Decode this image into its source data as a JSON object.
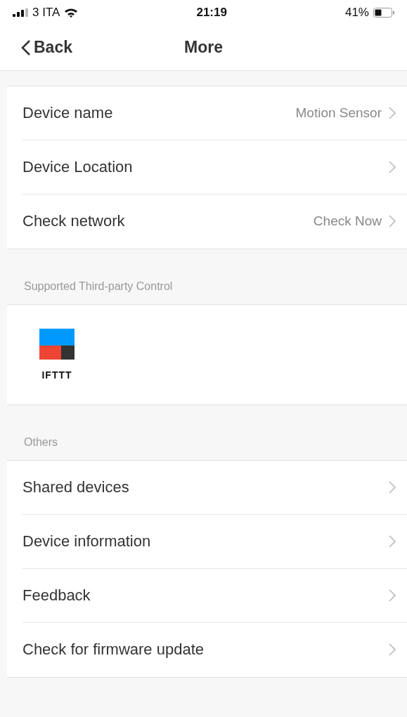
{
  "status_bar": {
    "carrier": "3 ITA",
    "time": "21:19",
    "battery": "41%"
  },
  "nav": {
    "back": "Back",
    "title": "More"
  },
  "basic_rows": [
    {
      "label": "Device name",
      "value": "Motion Sensor"
    },
    {
      "label": "Device Location"
    },
    {
      "label": "Check network",
      "value": "Check Now"
    }
  ],
  "third_party": {
    "header": "Supported Third-party Control",
    "services": [
      {
        "name": "IFTTT"
      }
    ]
  },
  "others": {
    "header": "Others",
    "rows": [
      {
        "label": "Shared devices"
      },
      {
        "label": "Device information"
      },
      {
        "label": "Feedback"
      },
      {
        "label": "Check for firmware update"
      }
    ]
  }
}
